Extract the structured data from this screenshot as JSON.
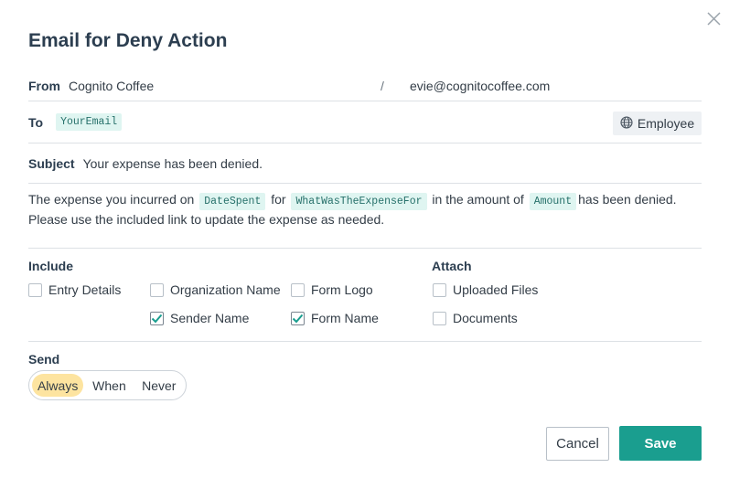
{
  "dialog": {
    "title": "Email for Deny Action"
  },
  "from": {
    "label": "From",
    "name": "Cognito Coffee",
    "separator": "/",
    "address": "evie@cognitocoffee.com"
  },
  "to": {
    "label": "To",
    "token": "YourEmail",
    "employee_button": "Employee"
  },
  "subject": {
    "label": "Subject",
    "value": "Your expense has been denied."
  },
  "message": {
    "part1": "The expense you incurred on",
    "token1": "DateSpent",
    "part2": "for",
    "token2": "WhatWasTheExpenseFor",
    "part3": "in the amount of",
    "token3": "Amount",
    "part4": "has been denied.",
    "line2": "Please use the included link to update the expense as needed."
  },
  "include": {
    "label": "Include",
    "options": [
      {
        "label": "Entry Details",
        "checked": false
      },
      {
        "label": "Organization Name",
        "checked": false
      },
      {
        "label": "Form Logo",
        "checked": false
      },
      {
        "label": "Sender Name",
        "checked": true
      },
      {
        "label": "Form Name",
        "checked": true
      }
    ]
  },
  "attach": {
    "label": "Attach",
    "options": [
      {
        "label": "Uploaded Files",
        "checked": false
      },
      {
        "label": "Documents",
        "checked": false
      }
    ]
  },
  "send": {
    "label": "Send",
    "options": [
      "Always",
      "When",
      "Never"
    ],
    "selected": "Always"
  },
  "actions": {
    "cancel": "Cancel",
    "save": "Save"
  },
  "colors": {
    "accent": "#1a9e8f",
    "token_bg": "#dff5f1",
    "selected_send": "#fde4a0",
    "title": "#2c3e50"
  },
  "icons": {
    "close": "close-icon",
    "globe": "globe-icon",
    "check": "check-icon"
  }
}
